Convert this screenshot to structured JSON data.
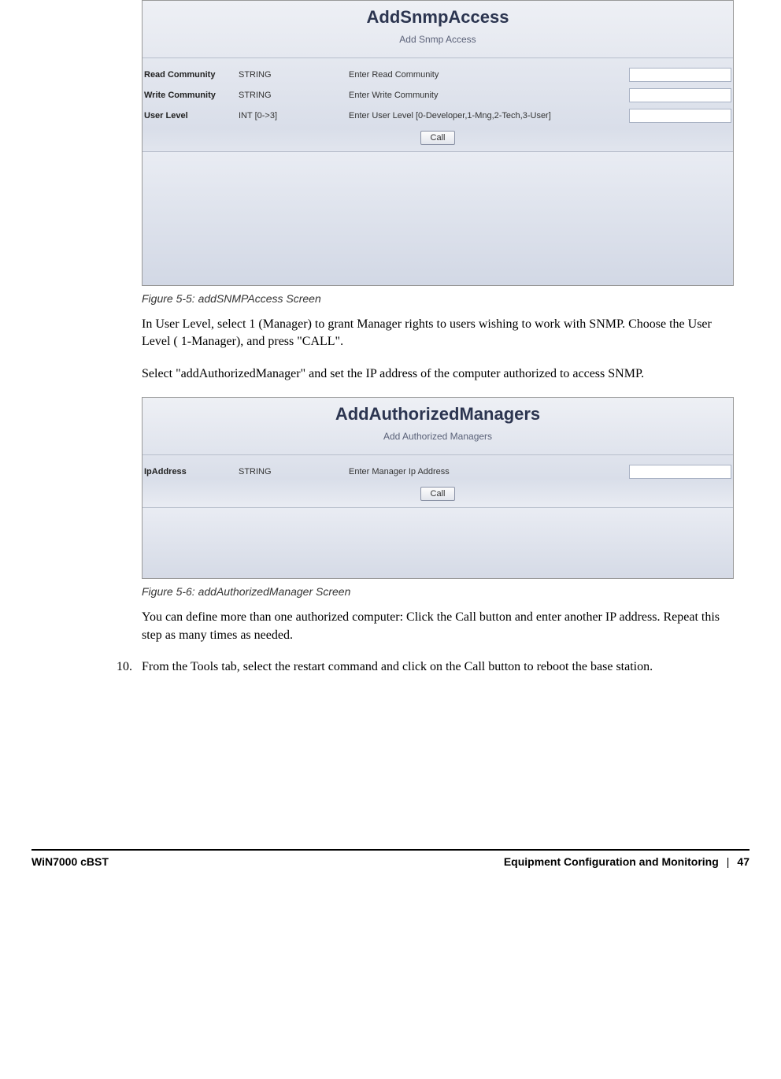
{
  "panel1": {
    "title": "AddSnmpAccess",
    "subtitle": "Add Snmp Access",
    "rows": [
      {
        "label": "Read Community",
        "type": "STRING",
        "desc": "Enter Read Community"
      },
      {
        "label": "Write Community",
        "type": "STRING",
        "desc": "Enter Write Community"
      },
      {
        "label": "User Level",
        "type": "INT [0->3]",
        "desc": "Enter User Level [0-Developer,1-Mng,2-Tech,3-User]"
      }
    ],
    "button": "Call"
  },
  "fig1_caption": "Figure 5-5: addSNMPAccess Screen",
  "para1": "In User Level, select 1 (Manager) to grant Manager rights to users wishing to work with SNMP. Choose the User Level ( 1-Manager), and press \"CALL\".",
  "para2": "Select \"addAuthorizedManager\" and set the IP address of the computer authorized to access SNMP.",
  "panel2": {
    "title": "AddAuthorizedManagers",
    "subtitle": "Add Authorized Managers",
    "rows": [
      {
        "label": "IpAddress",
        "type": "STRING",
        "desc": "Enter Manager Ip Address"
      }
    ],
    "button": "Call"
  },
  "fig2_caption": "Figure 5-6: addAuthorizedManager Screen",
  "para3": "You can define more than one authorized computer: Click the Call button and enter another IP address. Repeat this step as many times as needed.",
  "step10_num": "10.",
  "step10": "From the Tools tab, select the restart command and click on the Call button to reboot the base station.",
  "footer": {
    "left": "WiN7000 cBST",
    "right_section": "Equipment Configuration and Monitoring",
    "sep": "|",
    "page": "47"
  }
}
